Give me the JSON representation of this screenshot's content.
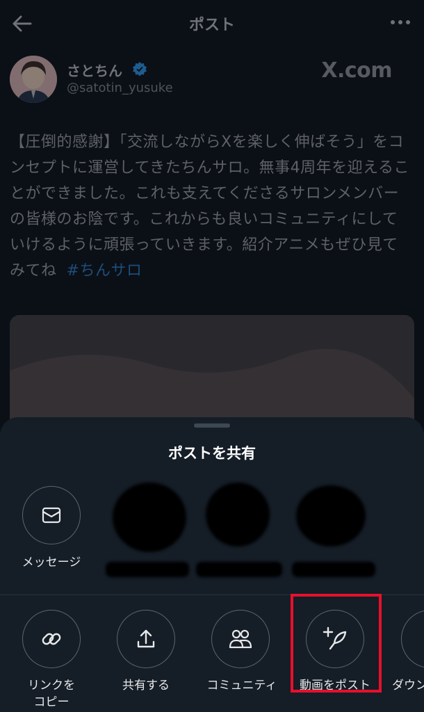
{
  "header": {
    "title": "ポスト",
    "back_icon": "arrow-left-icon",
    "more_icon": "more-horizontal-icon"
  },
  "author": {
    "name": "さとちん",
    "handle": "@satotin_yusuke",
    "verified_icon": "verified-badge-icon",
    "verified_color": "#1d9bf0",
    "watermark": "X.com"
  },
  "post": {
    "text": "【圧倒的感謝】「交流しながらXを楽しく伸ばそう」をコンセプトに運営してきたちんサロ。無事4周年を迎えることができました。これも支えてくださるサロンメンバーの皆様のお陰です。これからも良いコミュニティにしていけるように頑張っていきます。紹介アニメもぜひ見てみてね",
    "hashtag": "#ちんサロ"
  },
  "share_sheet": {
    "title": "ポストを共有",
    "top_row": [
      {
        "label": "メッセージ",
        "icon": "envelope-icon"
      }
    ],
    "bottom_row": [
      {
        "label_line1": "リンクを",
        "label_line2": "コピー",
        "icon": "link-icon"
      },
      {
        "label": "共有する",
        "icon": "share-upload-icon"
      },
      {
        "label": "コミュニティ",
        "icon": "community-people-icon"
      },
      {
        "label": "動画をポスト",
        "icon": "compose-feather-plus-icon"
      },
      {
        "label": "ダウン",
        "icon": "download-icon"
      }
    ],
    "highlight_color": "#e8102b"
  },
  "colors": {
    "background": "#0b0f16",
    "sheet": "#151d27",
    "accent": "#1d9bf0"
  }
}
